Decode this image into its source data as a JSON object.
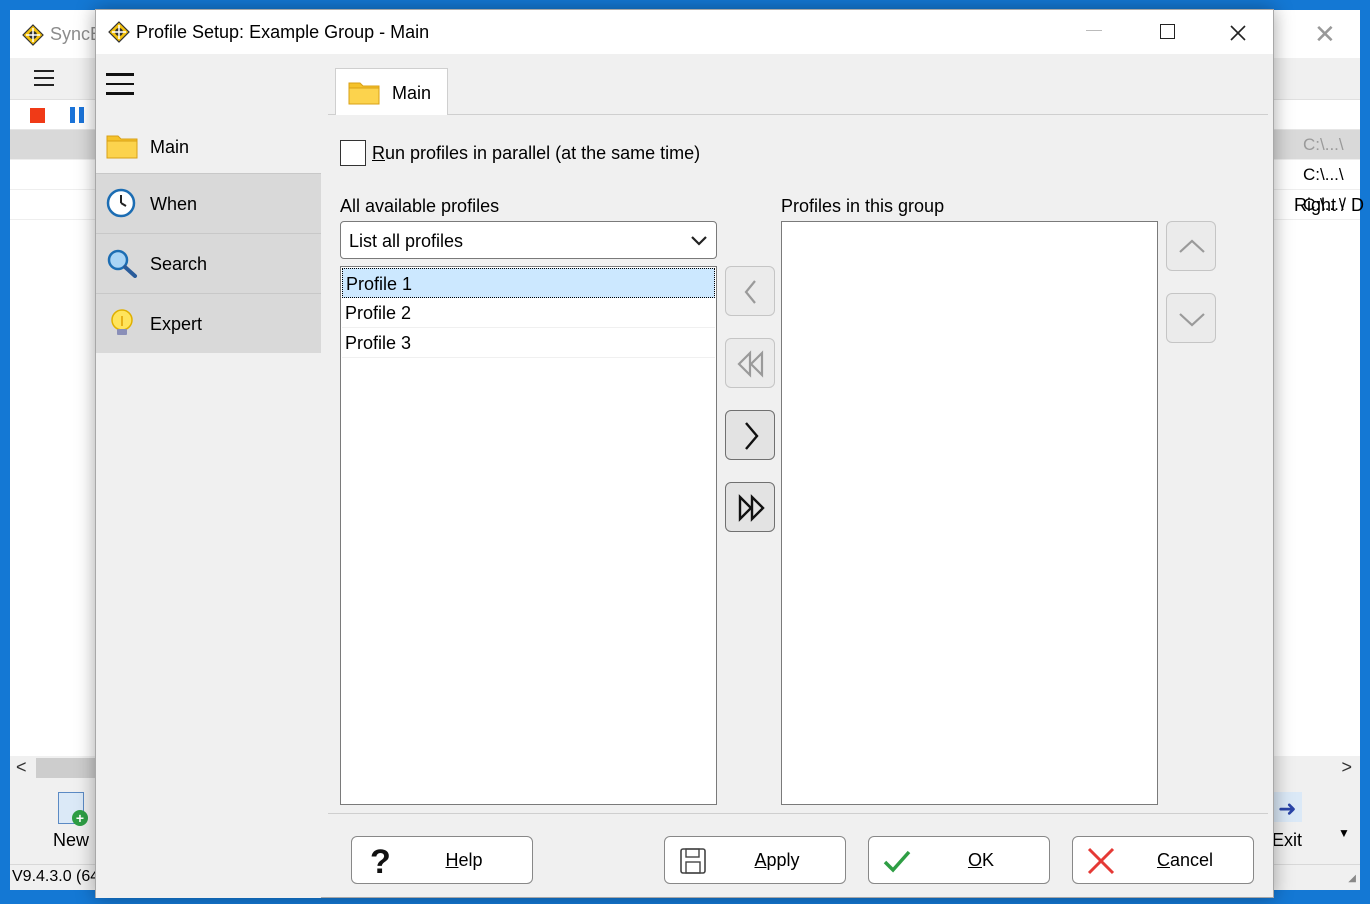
{
  "background_window": {
    "title": "SyncB",
    "right_column_header": "Right / D",
    "rows": [
      "C:\\...\\",
      "C:\\...\\",
      "C:\\...\\"
    ],
    "bottom_buttons": {
      "new": "New",
      "exit": "Exit"
    },
    "version": "V9.4.3.0 (64"
  },
  "dialog": {
    "title": "Profile Setup: Example Group - Main",
    "sidebar": {
      "items": [
        {
          "label": "Main",
          "icon": "folder-icon"
        },
        {
          "label": "When",
          "icon": "clock-icon"
        },
        {
          "label": "Search",
          "icon": "magnifier-icon"
        },
        {
          "label": "Expert",
          "icon": "lightbulb-icon"
        }
      ]
    },
    "tab": {
      "label": "Main"
    },
    "parallel_checkbox": {
      "label_first": "R",
      "label_rest": "un profiles in parallel (at the same time)",
      "checked": false
    },
    "available": {
      "label": "All available profiles",
      "filter_value": "List all profiles",
      "profiles": [
        "Profile 1",
        "Profile 2",
        "Profile 3"
      ],
      "selected_index": 0
    },
    "group": {
      "label": "Profiles in this group",
      "profiles": []
    },
    "footer": {
      "help": {
        "mnemonic": "H",
        "rest": "elp"
      },
      "apply": {
        "mnemonic": "A",
        "rest": "pply"
      },
      "ok": {
        "mnemonic": "O",
        "rest": "K"
      },
      "cancel": {
        "mnemonic": "C",
        "rest": "ancel"
      }
    },
    "colors": {
      "selection": "#cce8ff",
      "folder": "#f5c22a",
      "ok_check": "#2e9e44",
      "cancel_x": "#e53935",
      "stop": "#f03a17",
      "pause": "#1a73d8"
    }
  }
}
